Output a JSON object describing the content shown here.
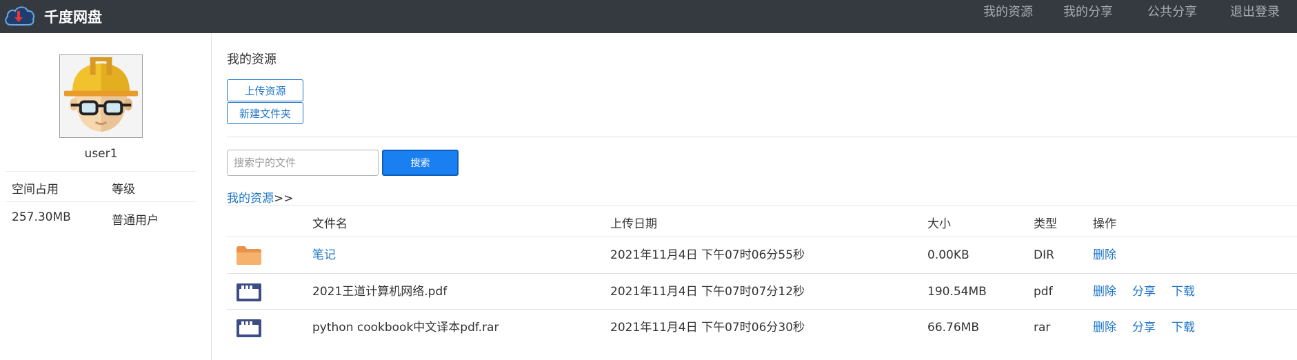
{
  "app": {
    "title": "千度网盘",
    "nav": [
      "我的资源",
      "我的分享",
      "公共分享",
      "退出登录"
    ]
  },
  "sidebar": {
    "username": "user1",
    "stats_headers": [
      "空间占用",
      "等级"
    ],
    "stats_values": [
      "257.30MB",
      "普通用户"
    ]
  },
  "main": {
    "section_title": "我的资源",
    "upload_label": "上传资源",
    "new_folder_label": "新建文件夹",
    "search_placeholder": "搜索宁的文件",
    "search_label": "搜索",
    "breadcrumb_link": "我的资源",
    "breadcrumb_sep": ">>"
  },
  "table": {
    "headers": [
      "文件名",
      "上传日期",
      "大小",
      "类型",
      "操作"
    ],
    "rows": [
      {
        "icon": "folder-icon",
        "name": "笔记",
        "date": "2021年11月4日 下午07时06分55秒",
        "size": "0.00KB",
        "type": "DIR",
        "actions": [
          "删除"
        ]
      },
      {
        "icon": "file-icon",
        "name": "2021王道计算机网络.pdf",
        "date": "2021年11月4日 下午07时07分12秒",
        "size": "190.54MB",
        "type": "pdf",
        "actions": [
          "删除",
          "分享",
          "下载"
        ]
      },
      {
        "icon": "file-icon",
        "name": "python cookbook中文译本pdf.rar",
        "date": "2021年11月4日 下午07时06分30秒",
        "size": "66.76MB",
        "type": "rar",
        "actions": [
          "删除",
          "分享",
          "下载"
        ]
      }
    ]
  },
  "colors": {
    "navbar": "#343a40",
    "link": "#1b73c7",
    "primary_button": "#1a7ff0",
    "folder": "#f4a85a",
    "file_icon": "#3d4d85"
  }
}
